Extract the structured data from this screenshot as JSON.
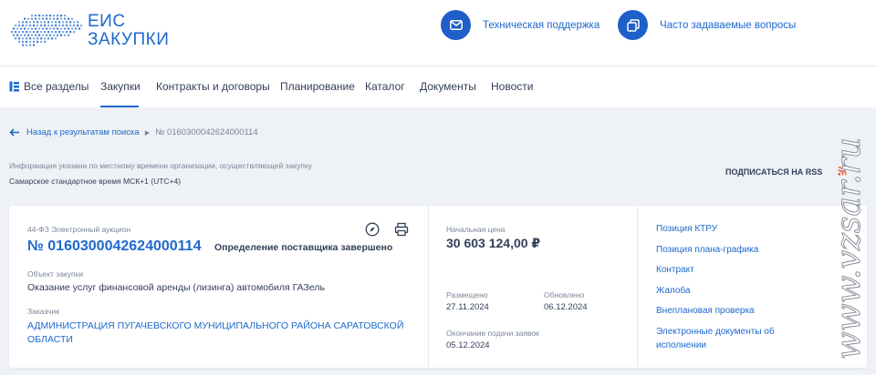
{
  "header": {
    "logo_line1": "ЕИС",
    "logo_line2": "ЗАКУПКИ",
    "support_label": "Техническая поддержка",
    "faq_label": "Часто задаваемые вопросы"
  },
  "nav": {
    "items": [
      {
        "label": "Все разделы"
      },
      {
        "label": "Закупки"
      },
      {
        "label": "Контракты и договоры"
      },
      {
        "label": "Планирование"
      },
      {
        "label": "Каталог"
      },
      {
        "label": "Документы"
      },
      {
        "label": "Новости"
      }
    ],
    "active": "Закупки"
  },
  "breadcrumb": {
    "back_label": "Назад к результатам поиска",
    "current": "№ 0160300042624000114"
  },
  "timezone": {
    "info": "Информация указана по местному времени организации, осуществляющей закупку",
    "value": "Самарское стандартное время МСК+1 (UTC+4)"
  },
  "rss_label": "ПОДПИСАТЬСЯ НА RSS",
  "card": {
    "law": "44-ФЗ Электронный аукцион",
    "number": "№ 0160300042624000114",
    "status": "Определение поставщика завершено",
    "object_label": "Объект закупки",
    "object_value": "Оказание услуг финансовой аренды (лизинга) автомобиля ГАЗель",
    "customer_label": "Заказчик",
    "customer_value": "АДМИНИСТРАЦИЯ ПУГАЧЕВСКОГО МУНИЦИПАЛЬНОГО РАЙОНА САРАТОВСКОЙ ОБЛАСТИ",
    "price_label": "Начальная цена",
    "price_value": "30 603 124,00 ₽",
    "posted_label": "Размещено",
    "posted_value": "27.11.2024",
    "updated_label": "Обновлено",
    "updated_value": "06.12.2024",
    "deadline_label": "Окончание подачи заявок",
    "deadline_value": "05.12.2024"
  },
  "links": [
    "Позиция КТРУ",
    "Позиция плана-графика",
    "Контракт",
    "Жалоба",
    "Внеплановая проверка",
    "Электронные документы об исполнении"
  ],
  "watermark": "www.vzsar.ru",
  "colors": {
    "brand_blue": "#1e69cc",
    "dark_text": "#334059",
    "muted_text": "#7b8699",
    "page_bg": "#eef1f5",
    "rss_orange": "#f05a28"
  },
  "icons": [
    "russia-map-logo-icon",
    "mail-icon",
    "faq-icon",
    "sections-icon",
    "arrow-left-icon",
    "compass-icon",
    "print-icon",
    "rss-icon"
  ]
}
